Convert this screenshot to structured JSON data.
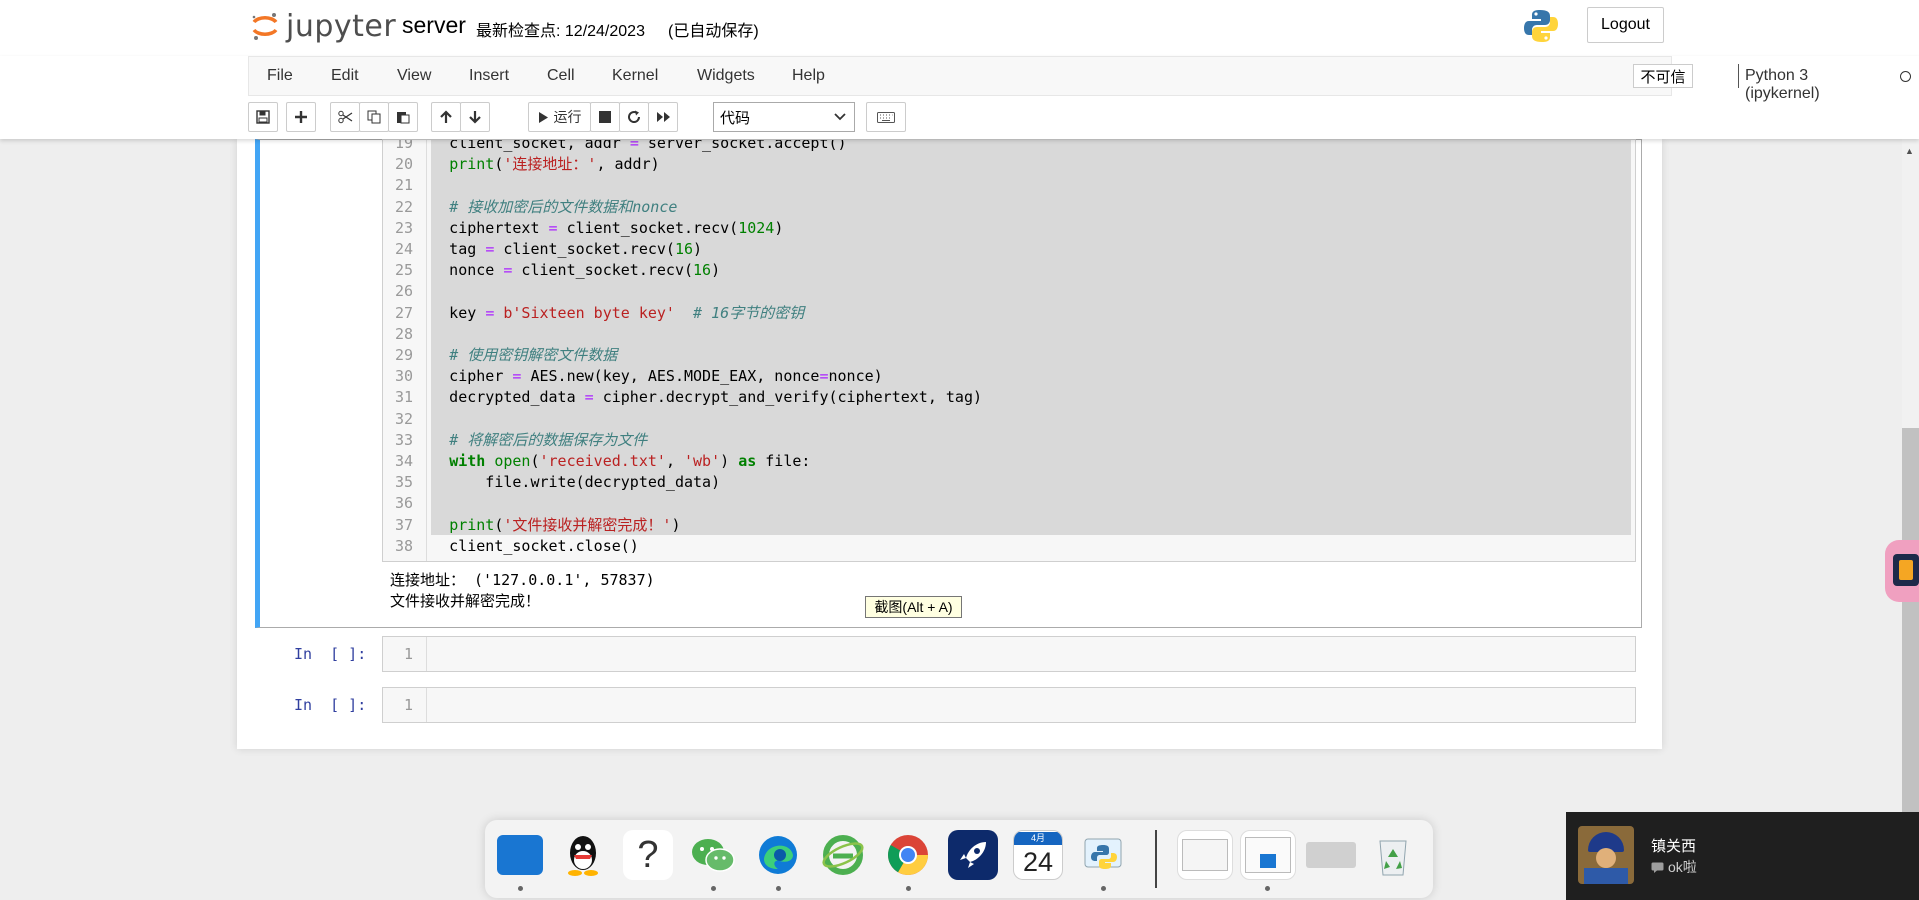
{
  "header": {
    "logo_text": "jupyter",
    "notebook_name": "server",
    "checkpoint": "最新检查点: 12/24/2023",
    "autosave": "(已自动保存)",
    "logout_label": "Logout"
  },
  "menu": {
    "items": [
      "File",
      "Edit",
      "View",
      "Insert",
      "Cell",
      "Kernel",
      "Widgets",
      "Help"
    ],
    "trust_label": "不可信",
    "kernel_name": "Python 3 (ipykernel)"
  },
  "toolbar": {
    "run_label": "运行",
    "cell_type": "代码"
  },
  "code_lines": [
    {
      "n": "19",
      "html": "    client_socket, addr <span class=\"op\">=</span> server_socket.accept()"
    },
    {
      "n": "20",
      "html": "    <span class=\"bi\">print</span>(<span class=\"str\">'连接地址：'</span>, addr)"
    },
    {
      "n": "21",
      "html": ""
    },
    {
      "n": "22",
      "html": "    <span class=\"cm\"># 接收加密后的文件数据和nonce</span>"
    },
    {
      "n": "23",
      "html": "    ciphertext <span class=\"op\">=</span> client_socket.recv(<span class=\"num\">1024</span>)"
    },
    {
      "n": "24",
      "html": "    tag <span class=\"op\">=</span> client_socket.recv(<span class=\"num\">16</span>)"
    },
    {
      "n": "25",
      "html": "    nonce <span class=\"op\">=</span> client_socket.recv(<span class=\"num\">16</span>)"
    },
    {
      "n": "26",
      "html": ""
    },
    {
      "n": "27",
      "html": "    key <span class=\"op\">=</span> <span class=\"str\">b'Sixteen byte key'</span>  <span class=\"cm\"># 16字节的密钥</span>"
    },
    {
      "n": "28",
      "html": ""
    },
    {
      "n": "29",
      "html": "    <span class=\"cm\"># 使用密钥解密文件数据</span>"
    },
    {
      "n": "30",
      "html": "    cipher <span class=\"op\">=</span> AES.new(key, AES.MODE_EAX, nonce<span class=\"op\">=</span>nonce)"
    },
    {
      "n": "31",
      "html": "    decrypted_data <span class=\"op\">=</span> cipher.decrypt_and_verify(ciphertext, tag)"
    },
    {
      "n": "32",
      "html": ""
    },
    {
      "n": "33",
      "html": "    <span class=\"cm\"># 将解密后的数据保存为文件</span>"
    },
    {
      "n": "34",
      "html": "    <span class=\"kw\">with</span> <span class=\"bi\">open</span>(<span class=\"str\">'received.txt'</span>, <span class=\"str\">'wb'</span>) <span class=\"kw\">as</span> file:"
    },
    {
      "n": "35",
      "html": "        file.write(decrypted_data)"
    },
    {
      "n": "36",
      "html": ""
    },
    {
      "n": "37",
      "html": "    <span class=\"bi\">print</span>(<span class=\"str\">'文件接收并解密完成！'</span>)"
    },
    {
      "n": "38",
      "html": "    client_socket.close()"
    }
  ],
  "output_lines": [
    "连接地址： ('127.0.0.1', 57837)",
    "文件接收并解密完成！"
  ],
  "tooltip": "截图(Alt + A)",
  "empty_cells": [
    {
      "prompt": "In  [ ]:",
      "line": "1"
    },
    {
      "prompt": "In  [ ]:",
      "line": "1"
    }
  ],
  "dock": {
    "calendar_month": "4月",
    "calendar_day": "24"
  },
  "notification": {
    "title": "镇关西",
    "body": "ok啦"
  },
  "colors": {
    "selected_cell_border": "#42a5f5",
    "prompt_in": "#303f9f",
    "string": "#ba2121",
    "keyword": "#008000",
    "comment": "#408080"
  }
}
